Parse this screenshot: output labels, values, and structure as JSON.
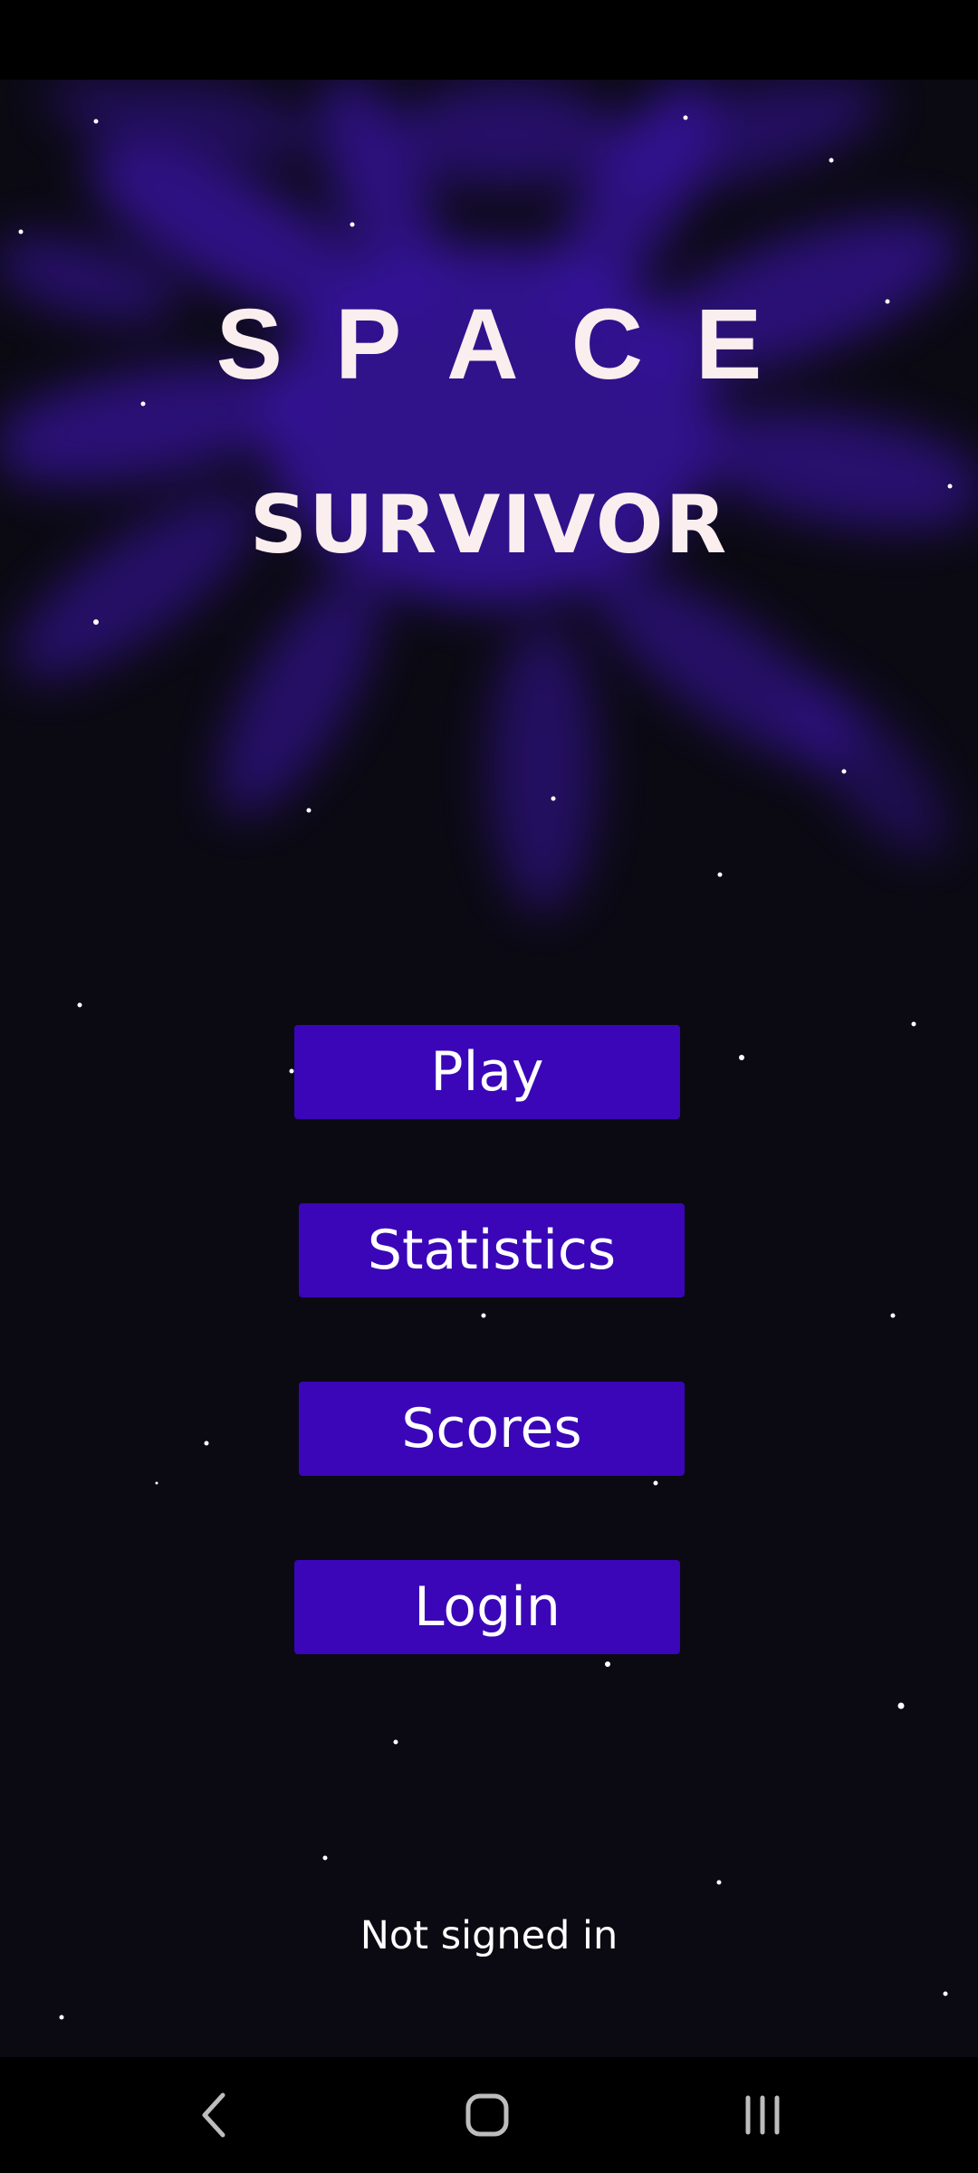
{
  "colors": {
    "background": "#0b0a13",
    "nebula": "#3a14a8",
    "title_text": "#fbeeee",
    "button_bg": "#3a06b8",
    "button_text": "#ffffff",
    "system_bars": "#000000"
  },
  "title": {
    "line1": "SPACE",
    "line2": "SURVIVOR"
  },
  "menu": {
    "play_label": "Play",
    "statistics_label": "Statistics",
    "scores_label": "Scores",
    "login_label": "Login"
  },
  "status": {
    "signin_text": "Not signed in"
  },
  "nav": {
    "back_icon": "chevron-left-icon",
    "home_icon": "rounded-square-home-icon",
    "recents_icon": "three-bars-recents-icon"
  }
}
